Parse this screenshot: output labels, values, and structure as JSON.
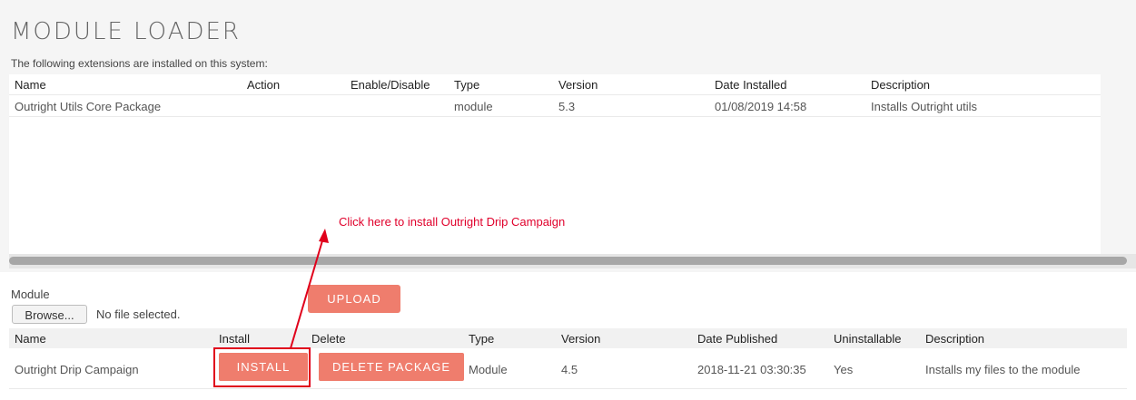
{
  "page": {
    "title": "MODULE LOADER",
    "installed_intro": "The following extensions are installed on this system:"
  },
  "installed_table": {
    "headers": [
      "Name",
      "Action",
      "Enable/Disable",
      "Type",
      "Version",
      "Date Installed",
      "Description"
    ],
    "rows": [
      {
        "name": "Outright Utils Core Package",
        "action": "",
        "enable_disable": "",
        "type": "module",
        "version": "5.3",
        "date_installed": "01/08/2019 14:58",
        "description": "Installs Outright utils"
      }
    ]
  },
  "annotation": {
    "text": "Click here to install Outright Drip Campaign",
    "color": "#e0002b"
  },
  "upload_form": {
    "module_label": "Module",
    "browse_label": "Browse...",
    "no_file_text": "No file selected.",
    "upload_label": "UPLOAD"
  },
  "package_table": {
    "headers": [
      "Name",
      "Install",
      "Delete",
      "Type",
      "Version",
      "Date Published",
      "Uninstallable",
      "Description"
    ],
    "rows": [
      {
        "name": "Outright Drip Campaign",
        "install_label": "INSTALL",
        "delete_label": "DELETE PACKAGE",
        "type": "Module",
        "version": "4.5",
        "date_published": "2018-11-21 03:30:35",
        "uninstallable": "Yes",
        "description": "Installs my files to the module"
      }
    ]
  },
  "colors": {
    "accent_button": "#ef7d6d",
    "highlight": "#e0001b"
  }
}
